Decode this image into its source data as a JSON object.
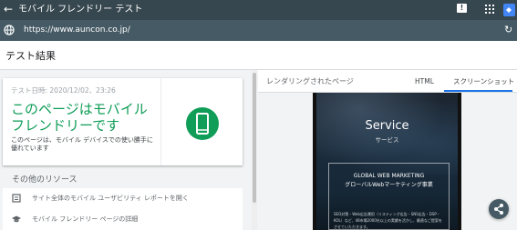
{
  "app_bar": {
    "title": "モバイル フレンドリー テスト",
    "back_glyph": "←",
    "feedback_glyph": "!",
    "icons": [
      "back-arrow-icon",
      "feedback-icon",
      "apps-grid-icon",
      "google-logo-icon"
    ]
  },
  "url_bar": {
    "url": "https://www.auncon.co.jp/",
    "refresh_glyph": "↻",
    "icons": [
      "globe-icon",
      "refresh-icon"
    ]
  },
  "results": {
    "title": "テスト結果",
    "test_date": "テスト日時: 2020/12/02、23:26",
    "headline": "このページはモバイル フレンドリーです",
    "description": "このページは、モバイル デバイスでの使い勝手に優れています",
    "status_color": "#0f9d58",
    "icons": [
      "smartphone-icon"
    ]
  },
  "resources": {
    "title": "その他のリソース",
    "items": [
      {
        "label": "サイト全体のモバイル ユーザビリティ レポートを開く",
        "icon": "report-icon"
      },
      {
        "label": "モバイル フレンドリー ページの詳細",
        "icon": "graduation-cap-icon"
      }
    ]
  },
  "rendered_page": {
    "title": "レンダリングされたページ",
    "tabs": [
      "HTML",
      "スクリーンショット"
    ],
    "active_tab": "スクリーンショット",
    "accent_color": "#1a73e8"
  },
  "screenshot": {
    "heading": "Service",
    "subheading": "サービス",
    "box_title": "GLOBAL WEB MARKETING",
    "box_subtitle": "グローバルWebマーケティング事業",
    "box_body": "SEO対策・Web広告運用（リスティング広告・SNS広告・DSP・KOL）など、48市場2000社以上の実績を活かし、最適なご提案をさせていただきます。"
  },
  "fab": {
    "icon": "share-icon"
  }
}
